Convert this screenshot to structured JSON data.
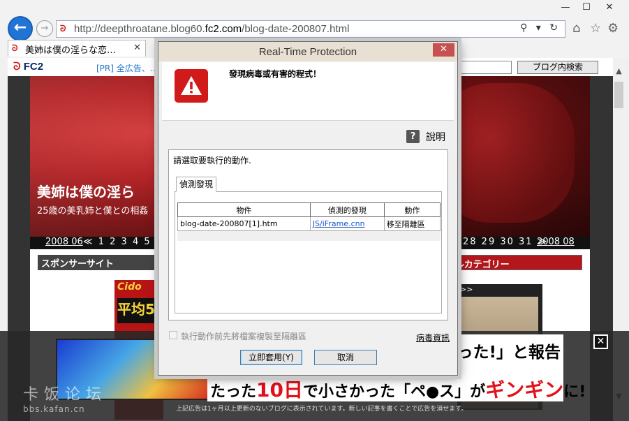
{
  "browser": {
    "url_prefix": "http://deepthroatane.blog60.",
    "url_host": "fc2.com",
    "url_suffix": "/blog-date-200807.html",
    "address_tools": "⚲ ▾ ↻",
    "tab_title": "美姉は僕の淫らな恋…",
    "window_controls": {
      "minimize": "—",
      "maximize": "☐",
      "close": "✕"
    },
    "icons": [
      "home-icon",
      "star-icon",
      "gear-icon",
      "back-arrow-icon",
      "forward-arrow-icon"
    ]
  },
  "page": {
    "fc2_logo": "FC2",
    "fc2_pr": "[PR] 全広告、…",
    "blog_search_button": "ブログ内検索",
    "hero_title": "美姉は僕の淫ら",
    "hero_subtitle": "25歳の美乳姉と僕との相姦",
    "date_nav": {
      "prev": "2008 06",
      "days_left": "≪ 1 2 3 4 5 6",
      "days_right": "28 29 30 31 ≫",
      "next": "2008 08"
    },
    "sponsor_header": "スポンサーサイト",
    "category_header": "ルカテゴリー",
    "sponsor_ad_title": "Cido",
    "sponsor_ad_badge": "平均5",
    "video_thumb_label": ">>"
  },
  "overlay_ad": {
    "text_top_a": "かった!」",
    "text_top_b": "と報告",
    "text_bottom_a": "たった",
    "text_bottom_big": "10日",
    "text_bottom_b": "で小さかった「ペ●ス」が",
    "text_bottom_c": "ギンギン",
    "text_bottom_d": "に!",
    "close": "✕",
    "footer": "上記広告は1ヶ月以上更新のないブログに表示されています。新しい記事を書くことで広告を消せます。"
  },
  "watermark": {
    "big": "卡饭论坛",
    "small": "bbs.kafan.cn"
  },
  "dialog": {
    "title": "Real-Time Protection",
    "close": "✕",
    "header_message": "發現病毒或有害的程式！",
    "help_label": "說明",
    "help_icon_glyph": "?",
    "action_prompt": "請選取要執行的動作.",
    "tab_label": "偵測發現",
    "table": {
      "headers": [
        "物件",
        "偵測的發現",
        "動作"
      ],
      "rows": [
        [
          "blog-date-200807[1].htm",
          "JS/iFrame.cnn",
          "移至隔離區"
        ]
      ]
    },
    "checkbox_label": "執行動作前先將檔案複製至隔離區",
    "virus_info_link": "病毒資訊",
    "apply_button": "立即套用(Y)",
    "cancel_button": "取消"
  },
  "colors": {
    "dialog_close": "#c75050",
    "warning_red": "#d11a1a",
    "link_blue": "#1a56c9",
    "ad_red": "#e3101a"
  }
}
